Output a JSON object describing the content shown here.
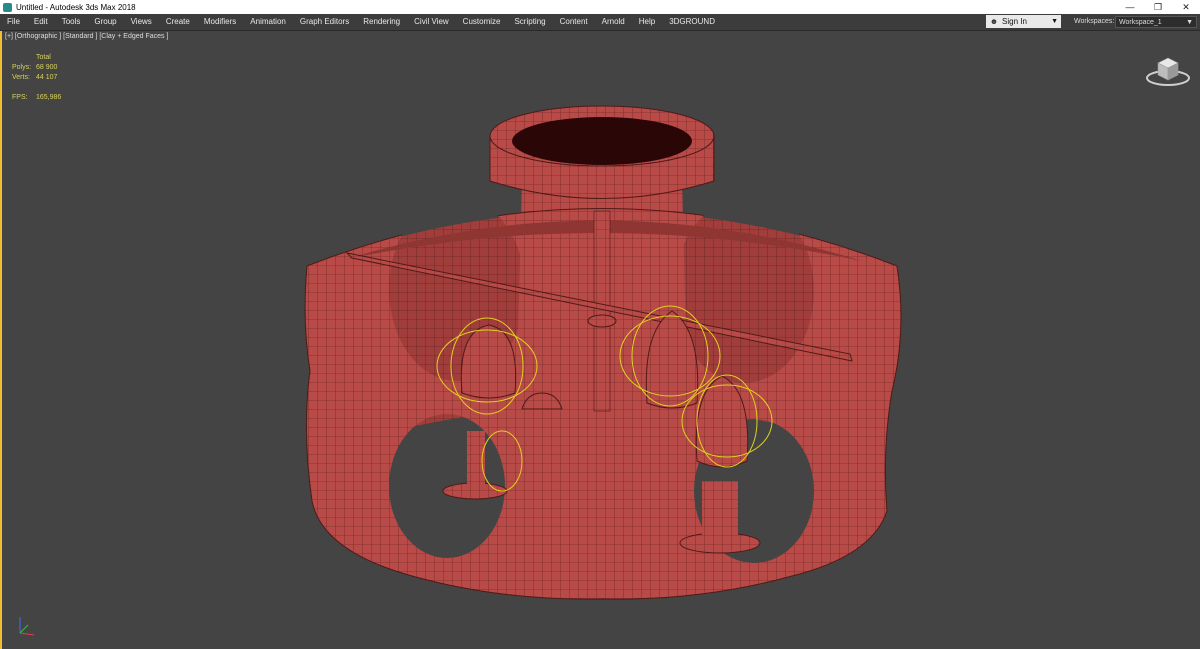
{
  "window": {
    "title": "Untitled - Autodesk 3ds Max 2018",
    "controls": [
      "—",
      "❐",
      "✕"
    ]
  },
  "menu": [
    "File",
    "Edit",
    "Tools",
    "Group",
    "Views",
    "Create",
    "Modifiers",
    "Animation",
    "Graph Editors",
    "Rendering",
    "Civil View",
    "Customize",
    "Scripting",
    "Content",
    "Arnold",
    "Help",
    "3DGROUND"
  ],
  "signin": {
    "label": "Sign In"
  },
  "workspaces": {
    "label": "Workspaces:",
    "value": "Workspace_1"
  },
  "viewport": {
    "label": "[+] [Orthographic ] [Standard ] [Clay + Edged Faces ]",
    "stats": {
      "header": "Total",
      "polys_label": "Polys:",
      "polys": "68 900",
      "verts_label": "Verts:",
      "verts": "44 107",
      "fps_label": "FPS:",
      "fps": "165,986"
    }
  },
  "colors": {
    "model": "#b84a47",
    "wire": "#5a1e1c",
    "gizmo": "#e0d020",
    "active_border": "#f0c030"
  }
}
